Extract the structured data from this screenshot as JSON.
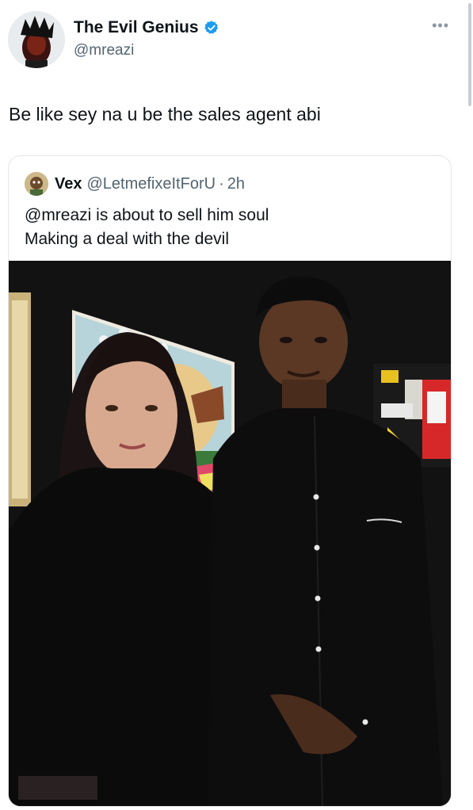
{
  "tweet": {
    "display_name": "The Evil Genius",
    "handle": "@mreazi",
    "text": "Be like sey na u be the sales agent abi",
    "more_icon": "more-horizontal-icon",
    "verified_icon": "verified-badge-icon",
    "verified_color": "#1d9bf0"
  },
  "quoted_tweet": {
    "display_name": "Vex",
    "handle": "@LetmefixeItForU",
    "separator": "·",
    "time": "2h",
    "text_lines": [
      "@mreazi is about to sell him soul",
      "Making a deal with the devil"
    ],
    "media": "photo"
  },
  "colors": {
    "text_primary": "#0f1419",
    "text_secondary": "#536471",
    "border": "#e3e6e9"
  }
}
